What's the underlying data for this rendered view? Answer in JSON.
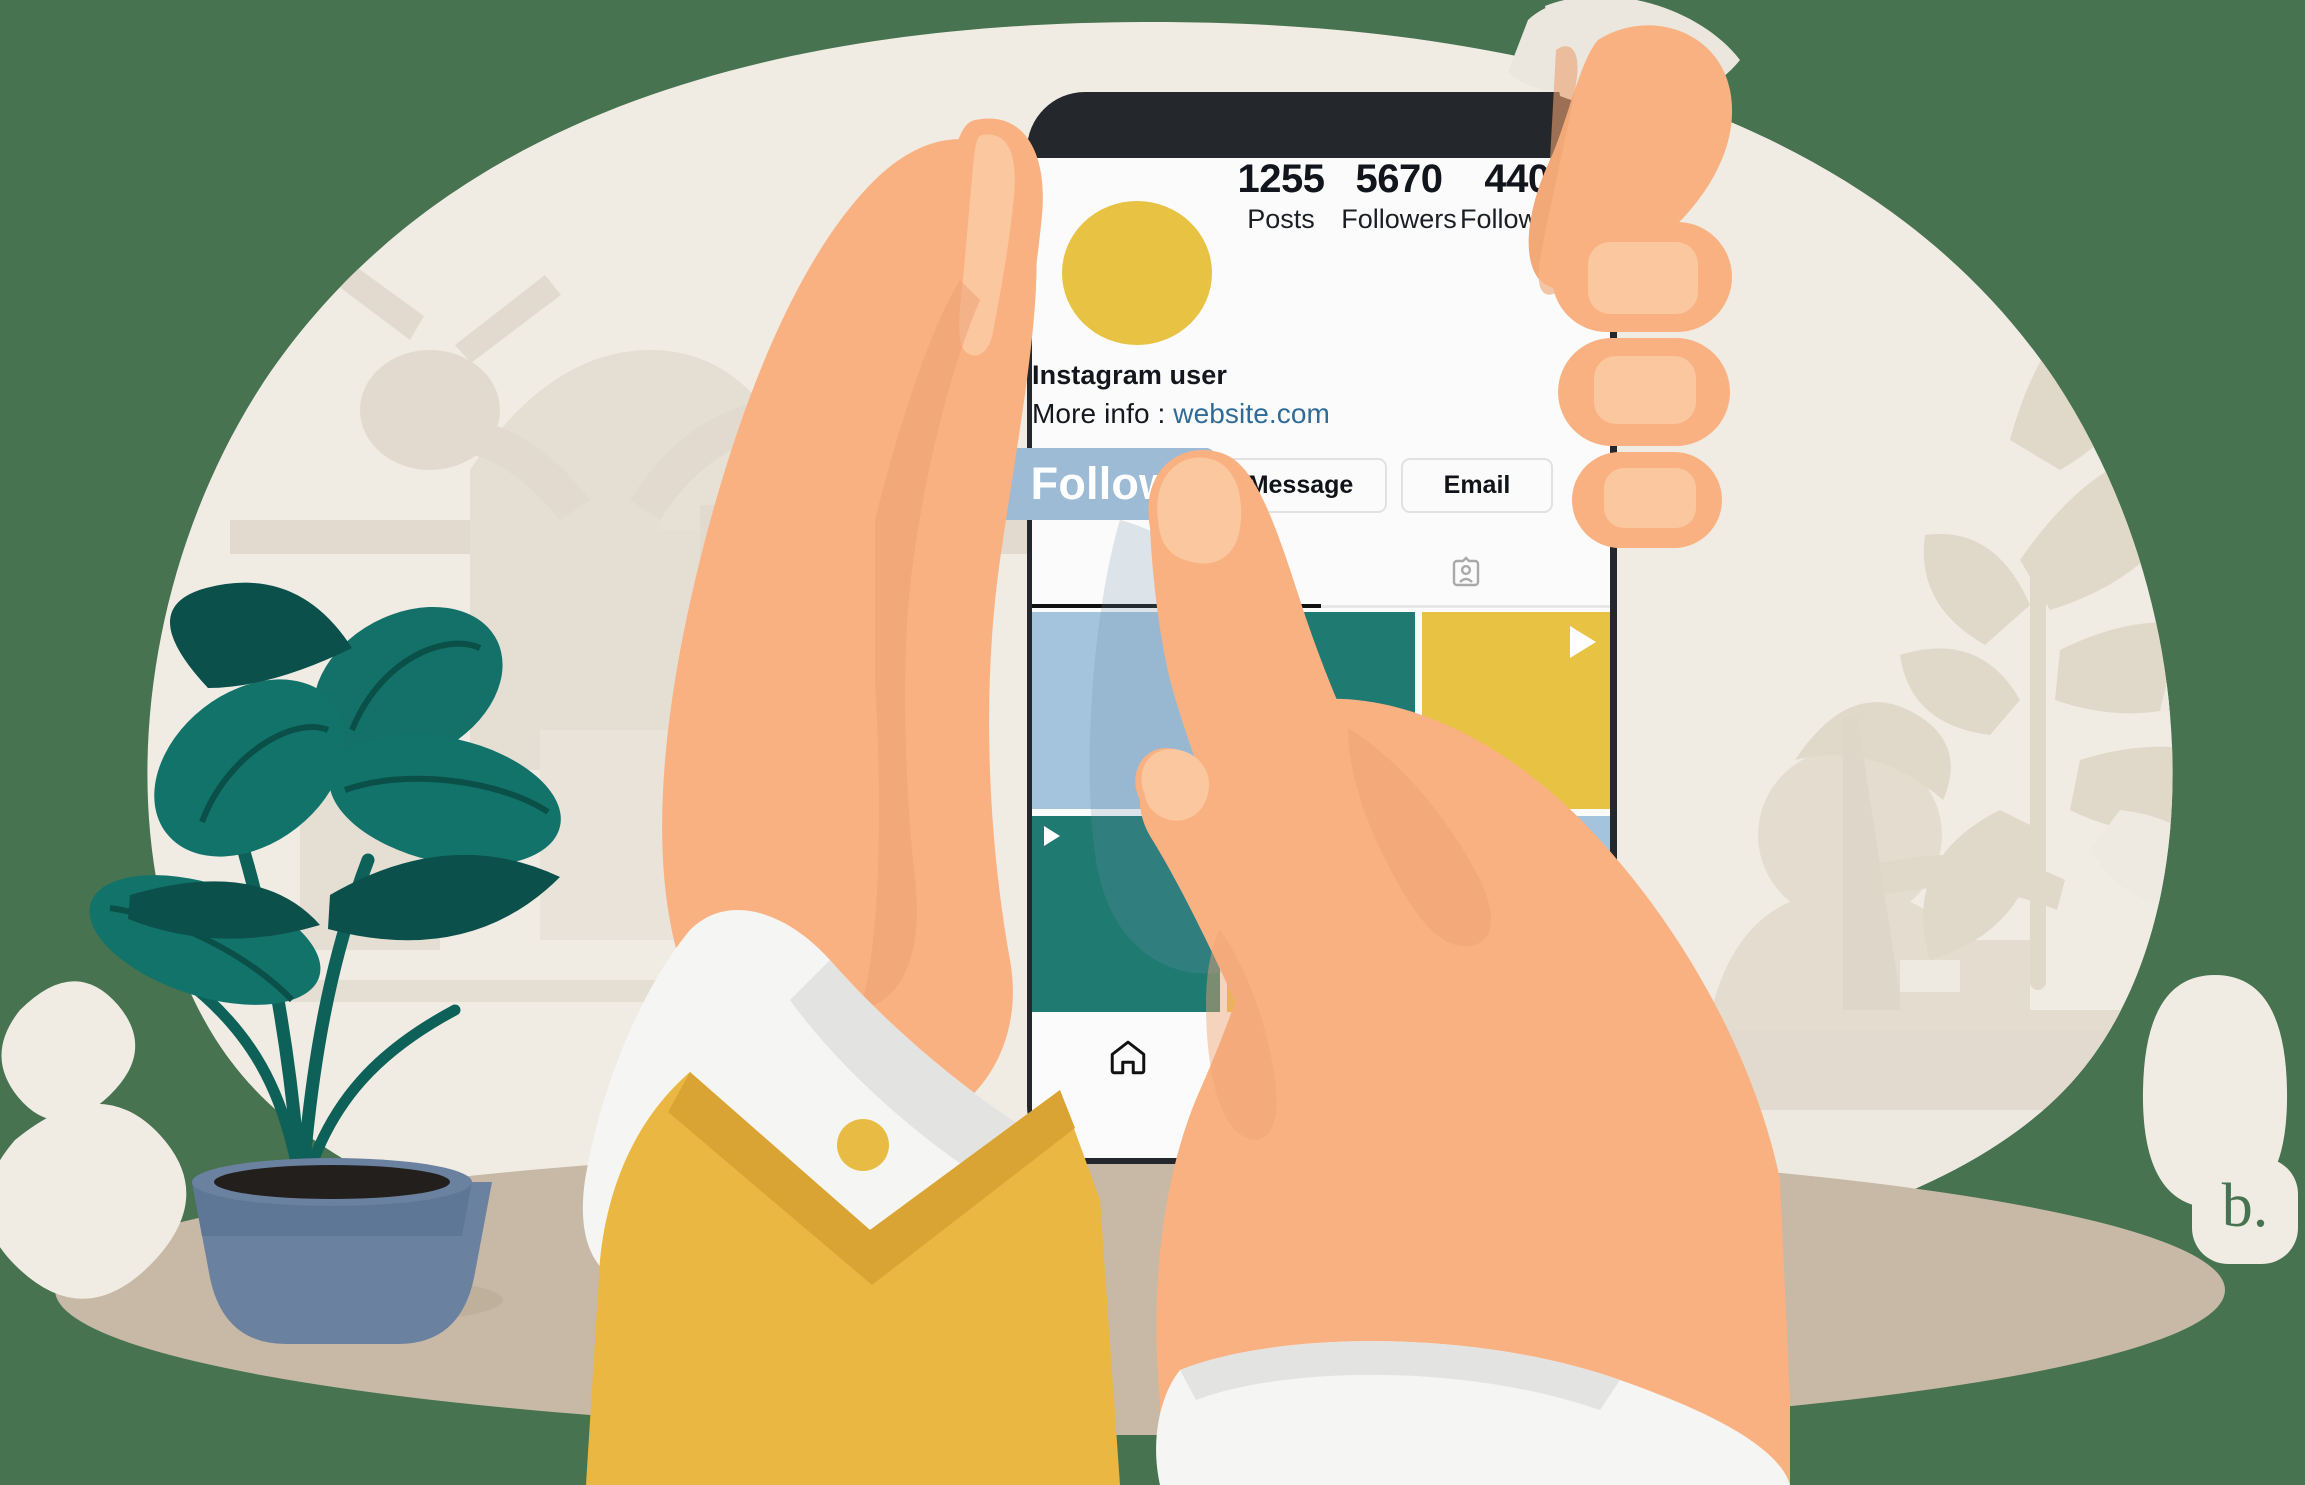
{
  "scene": {
    "title": "Instagram profile on smartphone held by hand, finger tapping Follow",
    "background_color": "#477350",
    "backdrop_blob_color": "#f0ece4",
    "ground_color": "#c7b9a5",
    "skin_color": "#f9b181",
    "skin_shadow": "#eda172",
    "nail_color": "#fbc79f",
    "cuff_color": "#f1f1f1",
    "sleeve_color": "#ebb743",
    "plant_leaf_dark": "#0b504b",
    "plant_leaf_mid": "#137169",
    "plant_pot_color": "#5f7797"
  },
  "phone": {
    "bezel_color": "#24272c",
    "screen_color": "#fbfbfb",
    "avatar_color": "#e8c243"
  },
  "profile": {
    "stats": [
      {
        "value": "1255",
        "label": "Posts"
      },
      {
        "value": "5670",
        "label": "Followers"
      },
      {
        "value": "440",
        "label": "Following"
      }
    ],
    "username": "Instagram user",
    "more_info_prefix": "More info : ",
    "website": "website.com",
    "website_color": "#2f6b96"
  },
  "actions": {
    "follow_label": "Follow",
    "follow_color": "#9dbbd4",
    "message_label": "Message",
    "email_label": "Email"
  },
  "tabs": [
    {
      "icon": "grid-icon",
      "active": true
    },
    {
      "icon": "tagged-person-icon",
      "active": false
    }
  ],
  "grid": {
    "cells": [
      {
        "color": "#a4c4de",
        "has_play": false
      },
      {
        "color": "#1f7a72",
        "has_play": false
      },
      {
        "color": "#e8c243",
        "has_play": true
      },
      {
        "color": "#1f7a72",
        "has_play": true
      },
      {
        "color": "#e8c243",
        "has_play": false
      },
      {
        "color": "#a4c4de",
        "has_play": false
      }
    ]
  },
  "bottom_nav": [
    {
      "icon": "home-icon"
    },
    {
      "icon": "search-icon"
    }
  ],
  "watermark": {
    "text": "b.",
    "badge_color": "#f0ece4",
    "text_color": "#477350"
  }
}
